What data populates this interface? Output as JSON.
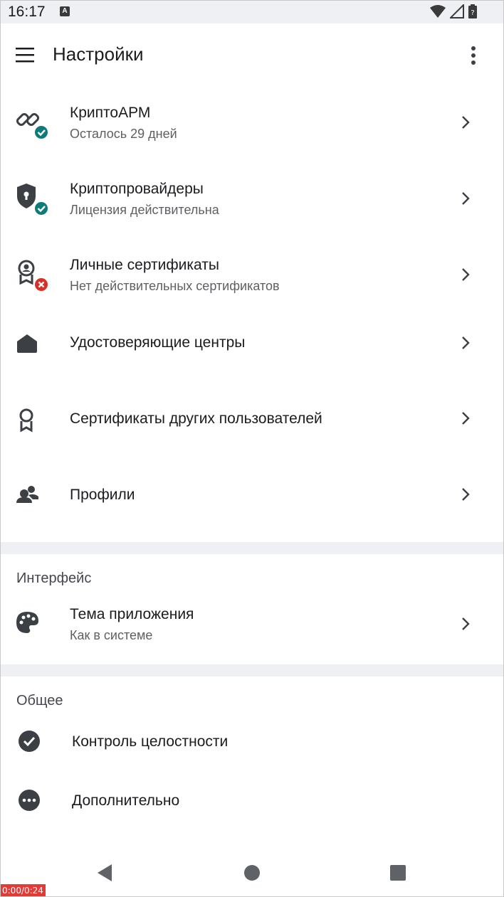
{
  "status_bar": {
    "time": "16:17",
    "a_badge": "A"
  },
  "app_bar": {
    "title": "Настройки",
    "menu_icon": "hamburger-menu-icon",
    "more_icon": "more-vertical-icon"
  },
  "items": [
    {
      "title": "КриптоАРМ",
      "subtitle": "Осталось 29 дней",
      "icon": "link-chain-icon",
      "badge": "check",
      "badge_color": "#0f7b78"
    },
    {
      "title": "Криптопровайдеры",
      "subtitle": "Лицензия действительна",
      "icon": "shield-lock-icon",
      "badge": "check",
      "badge_color": "#0f7b78"
    },
    {
      "title": "Личные сертификаты",
      "subtitle": "Нет действительных сертификатов",
      "icon": "certificate-person-icon",
      "badge": "error",
      "badge_color": "#d93025"
    },
    {
      "title": "Удостоверяющие центры",
      "icon": "home-icon"
    },
    {
      "title": "Сертификаты других пользователей",
      "icon": "award-ribbon-icon"
    },
    {
      "title": "Профили",
      "icon": "people-icon"
    }
  ],
  "interface_section": {
    "header": "Интерфейс",
    "items": [
      {
        "title": "Тема приложения",
        "subtitle": "Как в системе",
        "icon": "palette-icon"
      }
    ]
  },
  "general_section": {
    "header": "Общее",
    "items": [
      {
        "title": "Контроль целостности",
        "icon": "check-circle-icon"
      },
      {
        "title": "Дополнительно",
        "icon": "more-horizontal-circle-icon"
      }
    ]
  },
  "nav_bar": {
    "back_icon": "back-triangle-icon",
    "home_icon": "home-circle-icon",
    "recents_icon": "recents-square-icon"
  },
  "recording": {
    "timer": "0:00/0:24"
  },
  "colors": {
    "band": "#eef0f3",
    "icon": "#3c3f44",
    "ok": "#0f7b78",
    "error": "#d93025"
  }
}
